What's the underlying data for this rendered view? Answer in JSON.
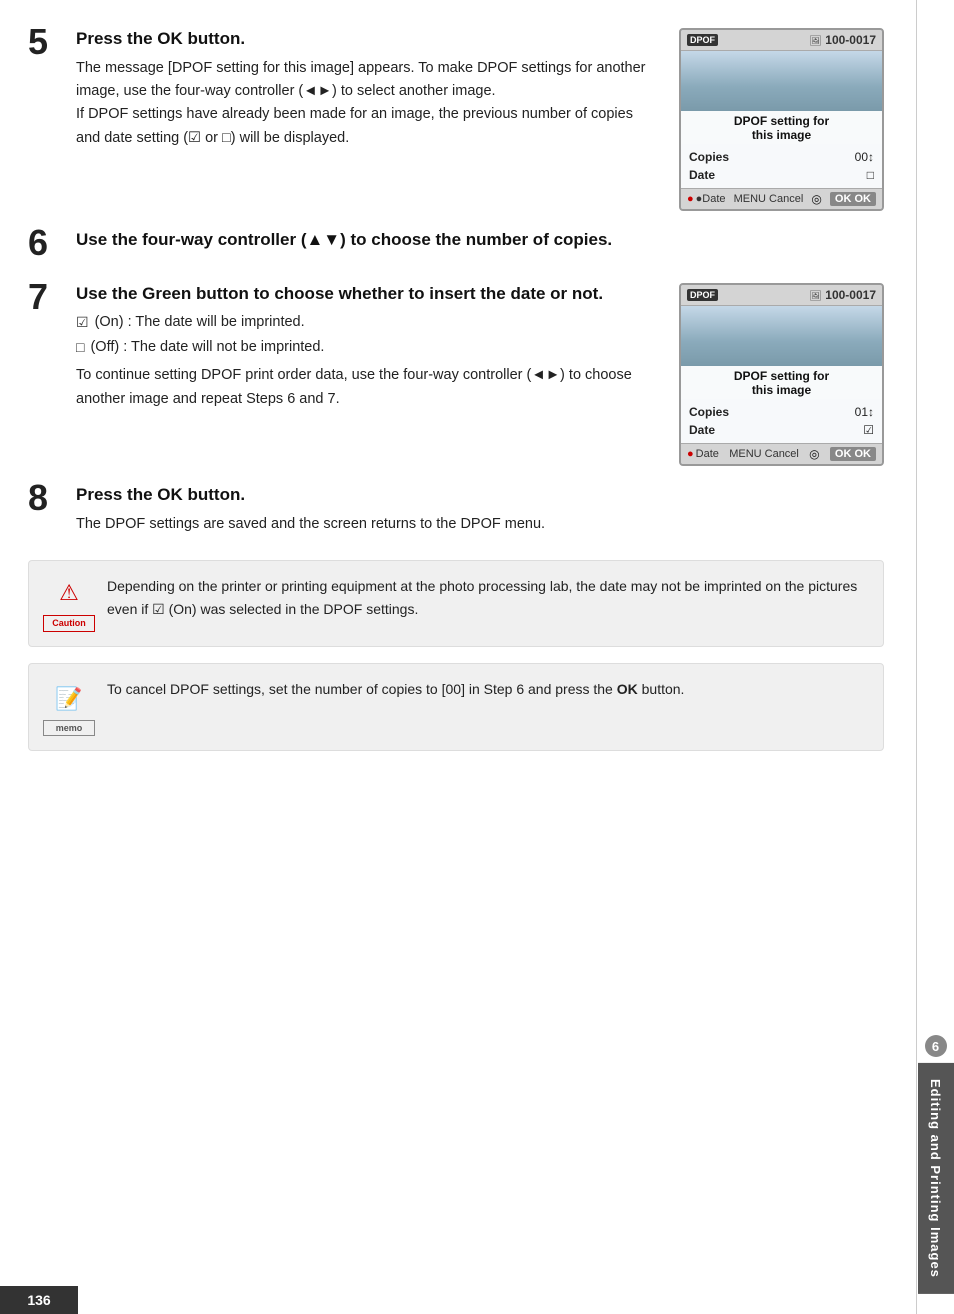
{
  "page": {
    "number": "136",
    "sidebar_number": "6",
    "sidebar_label": "Editing and Printing Images"
  },
  "steps": {
    "step5": {
      "number": "5",
      "title_before_ok": "Press the ",
      "ok_text": "OK",
      "title_after_ok": " button.",
      "body": "The message [DPOF setting for this image] appears. To make DPOF settings for another image, use the four-way controller (◄►) to select another image.\nIf DPOF settings have already been made for an image, the previous number of copies and date setting (☑ or □) will be displayed."
    },
    "step6": {
      "number": "6",
      "title": "Use the four-way controller (▲▼) to choose the number of copies."
    },
    "step7": {
      "number": "7",
      "title": "Use the Green button to choose whether to insert the date or not.",
      "item1_check": "☑",
      "item1_label": "(On) : The date will be imprinted.",
      "item2_check": "□",
      "item2_label": "(Off) : The date will not be imprinted.",
      "body2": "To continue setting DPOF print order data, use the four-way controller (◄►) to choose another image and repeat Steps 6 and 7."
    },
    "step8": {
      "number": "8",
      "title_before_ok": "Press the ",
      "ok_text": "OK",
      "title_after_ok": " button.",
      "body": "The DPOF settings are saved and the screen returns to the DPOF menu."
    }
  },
  "camera_screen_1": {
    "dpof_icon": "DPOF",
    "file_icon": "🖼",
    "file_number": "100-0017",
    "title_line1": "DPOF setting for",
    "title_line2": "this image",
    "copies_label": "Copies",
    "copies_value": "00↕",
    "date_label": "Date",
    "date_value": "□",
    "date_bottom": "●Date",
    "menu_cancel": "MENU Cancel",
    "nav_icon": "◎",
    "ok_label": "OK OK"
  },
  "camera_screen_2": {
    "dpof_icon": "DPOF",
    "file_icon": "🖼",
    "file_number": "100-0017",
    "title_line1": "DPOF setting for",
    "title_line2": "this image",
    "copies_label": "Copies",
    "copies_value": "01↕",
    "date_label": "Date",
    "date_value": "☑",
    "date_bottom": "●Date",
    "menu_cancel": "MENU Cancel",
    "nav_icon": "◎",
    "ok_label": "OK OK"
  },
  "notes": {
    "caution": {
      "icon_label": "Caution",
      "text": "Depending on the printer or printing equipment at the photo processing lab, the date may not be imprinted on the pictures even if ☑ (On) was selected in the DPOF settings."
    },
    "memo": {
      "icon_label": "memo",
      "text_before_ok": "To cancel DPOF settings, set the number of copies to [00] in Step 6 and press the ",
      "ok_text": "OK",
      "text_after_ok": " button."
    }
  }
}
